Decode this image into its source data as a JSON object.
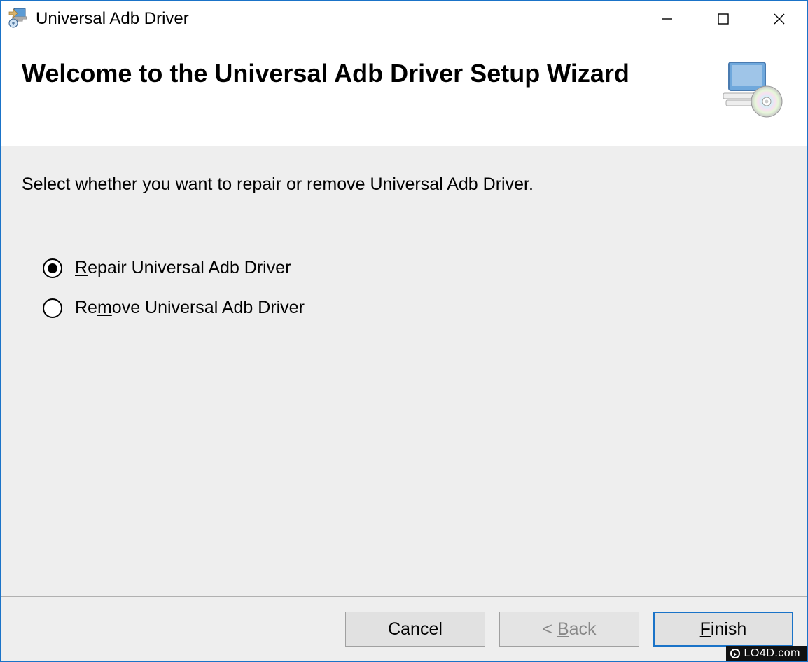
{
  "window": {
    "title": "Universal Adb Driver"
  },
  "header": {
    "heading": "Welcome to the Universal Adb Driver Setup Wizard"
  },
  "body": {
    "instruction": "Select whether you want to repair or remove Universal Adb Driver.",
    "options": [
      {
        "label_pre": "",
        "mnemonic": "R",
        "label_post": "epair Universal Adb Driver",
        "selected": true
      },
      {
        "label_pre": "Re",
        "mnemonic": "m",
        "label_post": "ove Universal Adb Driver",
        "selected": false
      }
    ]
  },
  "footer": {
    "buttons": {
      "cancel": {
        "label": "Cancel",
        "enabled": true,
        "default": false
      },
      "back": {
        "prefix": "< ",
        "mnemonic": "B",
        "rest": "ack",
        "enabled": false,
        "default": false
      },
      "finish": {
        "mnemonic": "F",
        "rest": "inish",
        "enabled": true,
        "default": true
      }
    }
  },
  "watermark": "LO4D.com"
}
